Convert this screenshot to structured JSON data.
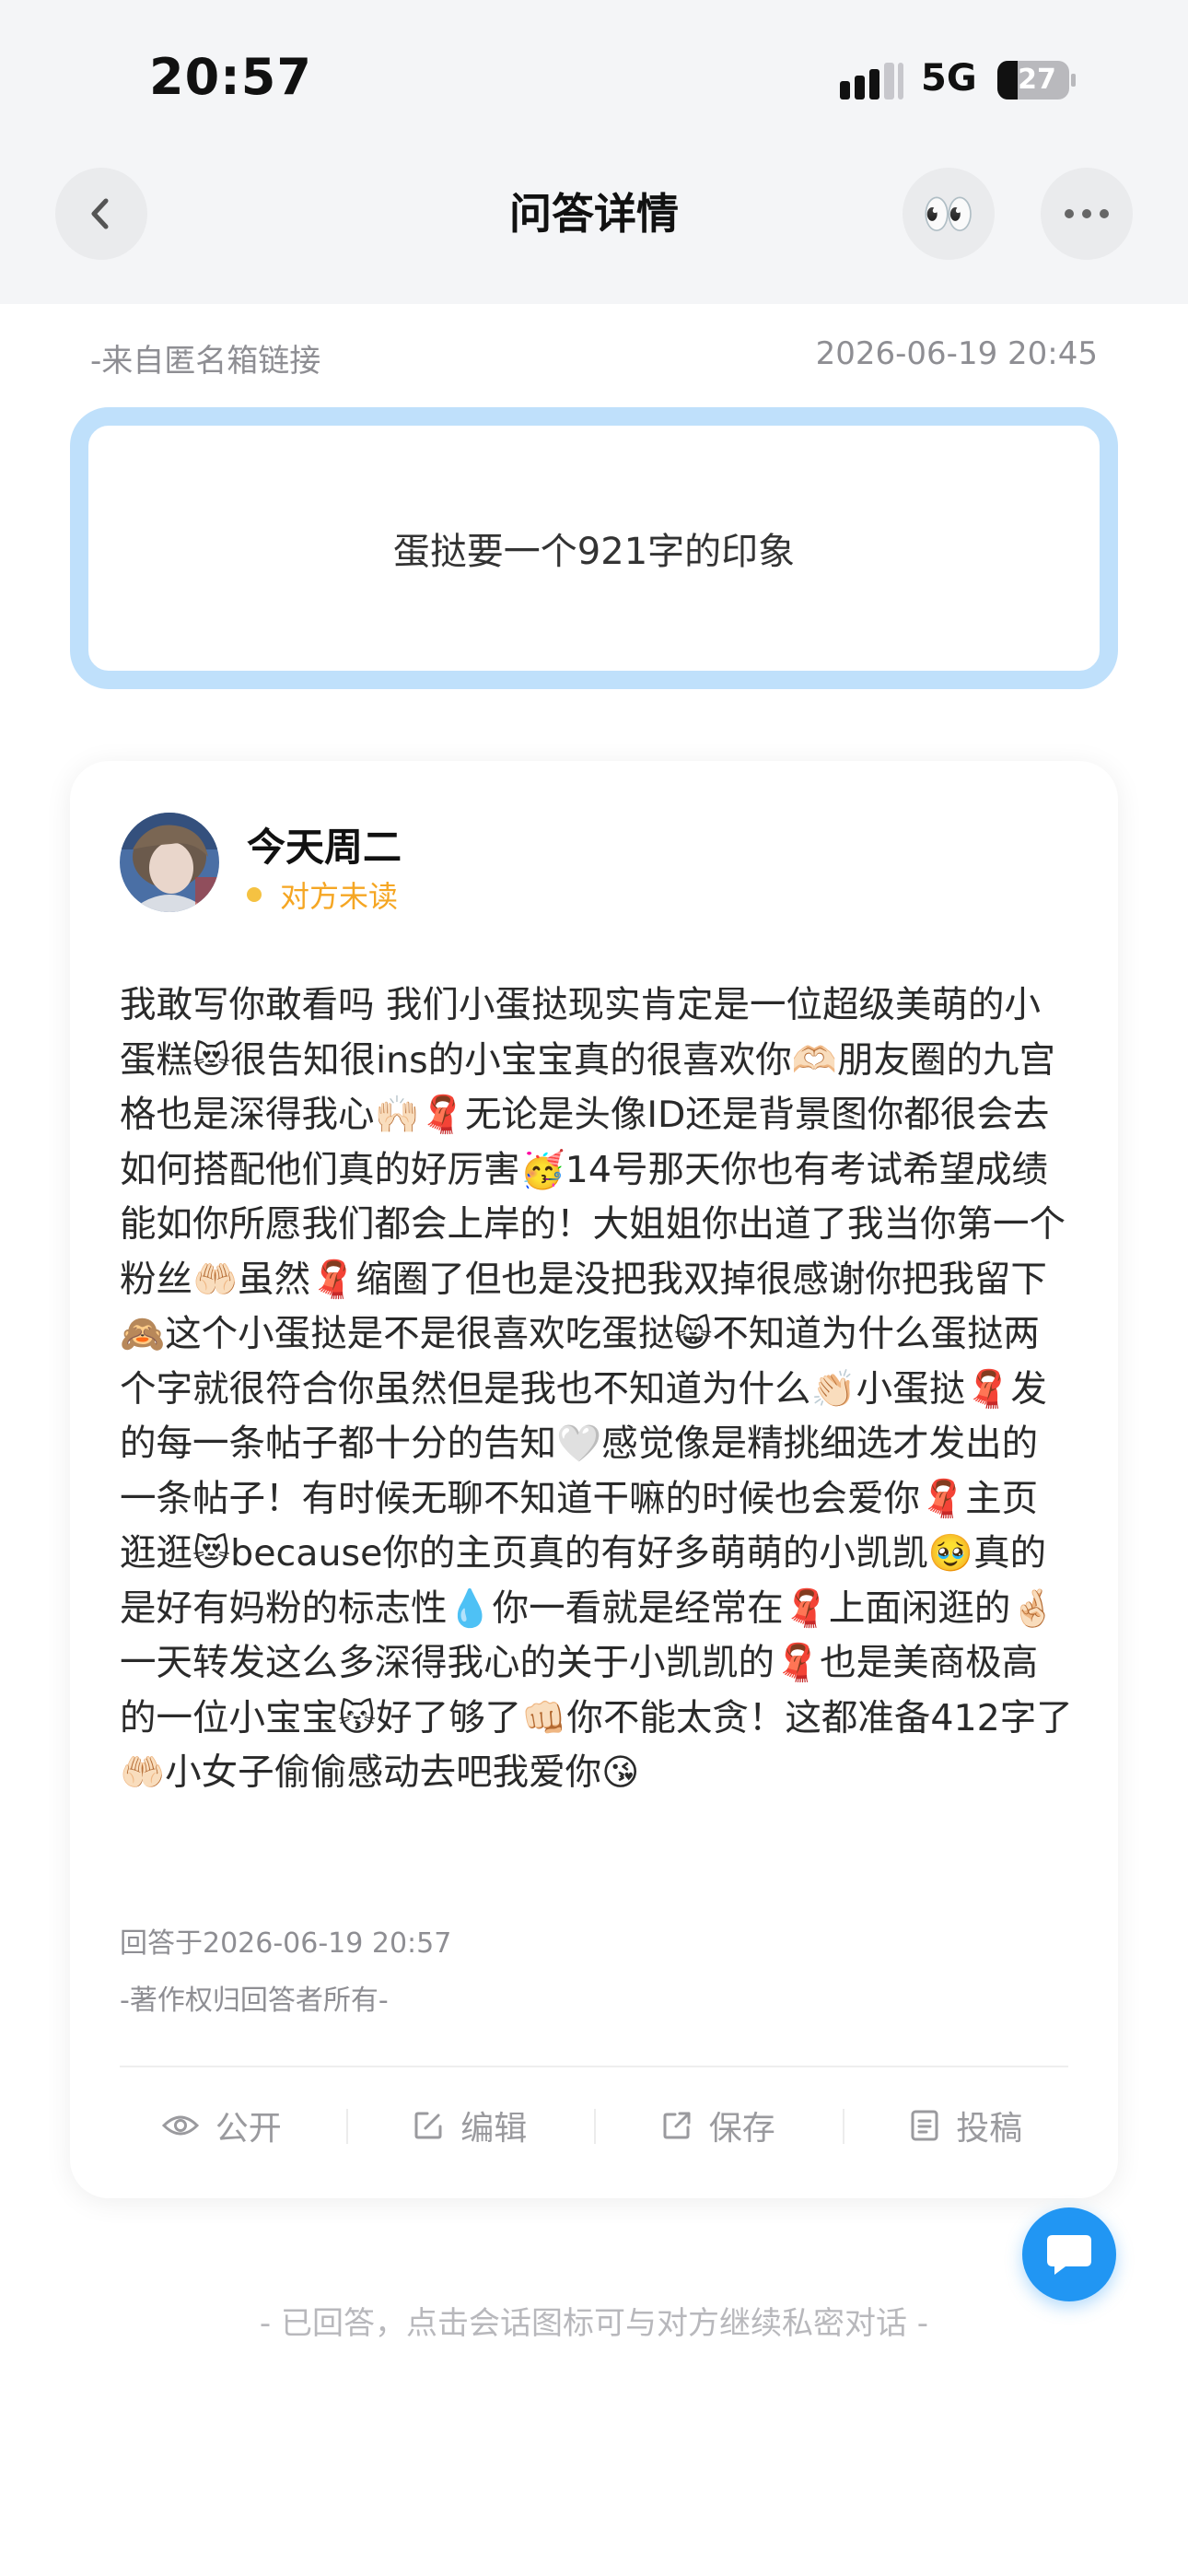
{
  "status_bar": {
    "time": "20:57",
    "network": "5G",
    "battery": "27"
  },
  "nav": {
    "title": "问答详情",
    "back_icon": "chevron-left-icon",
    "eyes_emoji": "👀",
    "more_icon": "ellipsis-icon"
  },
  "question": {
    "source": "-来自匿名箱链接",
    "time": "2026-06-19 20:45",
    "text": "蛋挞要一个921字的印象"
  },
  "answer": {
    "user_name": "今天周二",
    "read_status": "对方未读",
    "body": "我敢写你敢看吗 我们小蛋挞现实肯定是一位超级美萌的小蛋糕😻很告知很ins的小宝宝真的很喜欢你🫶🏻朋友圈的九宫格也是深得我心🙌🏻🧣无论是头像ID还是背景图你都很会去如何搭配他们真的好厉害🥳14号那天你也有考试希望成绩能如你所愿我们都会上岸的！大姐姐你出道了我当你第一个粉丝🤲🏻虽然🧣缩圈了但也是没把我双掉很感谢你把我留下🙈这个小蛋挞是不是很喜欢吃蛋挞😸不知道为什么蛋挞两个字就很符合你虽然但是我也不知道为什么👏🏻小蛋挞🧣发的每一条帖子都十分的告知🤍感觉像是精挑细选才发出的一条帖子！有时候无聊不知道干嘛的时候也会爱你🧣主页逛逛😻because你的主页真的有好多萌萌的小凯凯🥹真的是好有妈粉的标志性💧你一看就是经常在🧣上面闲逛的🤞🏻一天转发这么多深得我心的关于小凯凯的🧣也是美商极高的一位小宝宝😽好了够了👊🏻你不能太贪！这都准备412字了🤲🏻小女子偷偷感动去吧我爱你😘",
    "time": "回答于2026-06-19 20:57",
    "copyright": "-著作权归回答者所有-"
  },
  "actions": [
    {
      "label": "公开",
      "icon": "eye-icon"
    },
    {
      "label": "编辑",
      "icon": "edit-icon"
    },
    {
      "label": "保存",
      "icon": "share-icon"
    },
    {
      "label": "投稿",
      "icon": "document-icon"
    }
  ],
  "footer_hint": "- 已回答，点击会话图标可与对方继续私密对话 -",
  "colors": {
    "accent_blue": "#2196f3",
    "question_border": "#bfe0fb",
    "unread_orange": "#f5a623",
    "muted_gray": "#8e8e93"
  }
}
